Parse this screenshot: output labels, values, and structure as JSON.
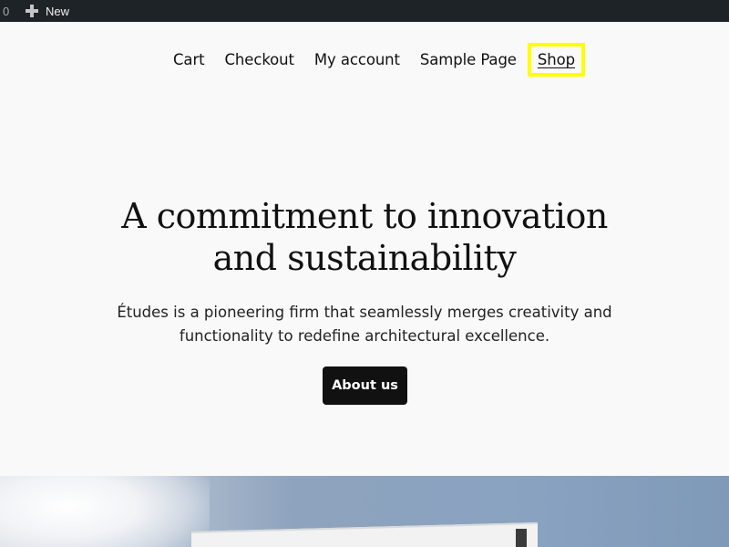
{
  "admin_bar": {
    "count": "0",
    "new_label": "New",
    "new_icon": "plus-icon"
  },
  "nav": {
    "items": [
      {
        "label": "Cart"
      },
      {
        "label": "Checkout"
      },
      {
        "label": "My account"
      },
      {
        "label": "Sample Page"
      },
      {
        "label": "Shop",
        "active": true
      }
    ]
  },
  "hero": {
    "title_line1": "A commitment to innovation",
    "title_line2": "and sustainability",
    "text_line1": "Études is a pioneering firm that seamlessly merges creativity and",
    "text_line2": "functionality to redefine architectural excellence.",
    "button_label": "About us"
  },
  "colors": {
    "admin_bar_bg": "#1d2327",
    "page_bg": "#f9f9f9",
    "button_bg": "#111111",
    "focus_highlight": "#ffff00"
  }
}
